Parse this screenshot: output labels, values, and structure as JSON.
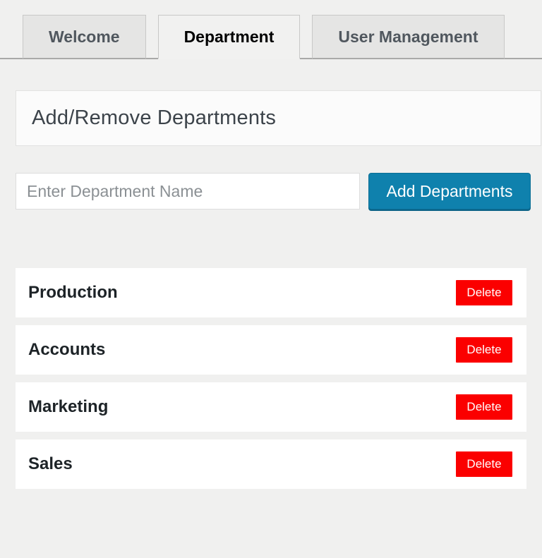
{
  "tabs": [
    {
      "label": "Welcome",
      "active": false
    },
    {
      "label": "Department",
      "active": true
    },
    {
      "label": "User Management",
      "active": false
    }
  ],
  "panel": {
    "title": "Add/Remove Departments"
  },
  "form": {
    "input_placeholder": "Enter Department Name",
    "input_value": "",
    "add_button_label": "Add Departments"
  },
  "departments": [
    {
      "name": "Production",
      "delete_label": "Delete"
    },
    {
      "name": "Accounts",
      "delete_label": "Delete"
    },
    {
      "name": "Marketing",
      "delete_label": "Delete"
    },
    {
      "name": "Sales",
      "delete_label": "Delete"
    }
  ],
  "colors": {
    "page_background": "#f0f0ef",
    "inactive_tab_background": "#e5e5e4",
    "active_tab_background": "#f1f1f0",
    "primary_button": "#0f81ad",
    "delete_button": "#fb0000"
  }
}
